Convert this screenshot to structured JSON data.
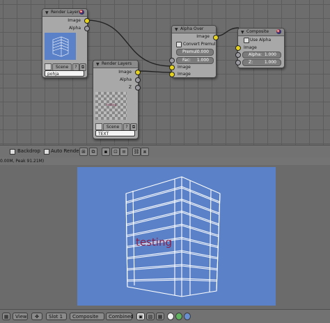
{
  "nodes": {
    "render_layers_1": {
      "title": "Render Layers",
      "outputs": [
        "Image",
        "Alpha"
      ],
      "scene_label": "Scene",
      "layer_value": "pohja"
    },
    "render_layers_2": {
      "title": "Render Layers",
      "outputs": [
        "Image",
        "Alpha",
        "Z"
      ],
      "preview_text": "testing",
      "scene_label": "Scene",
      "layer_value": "TEXT"
    },
    "alpha_over": {
      "title": "Alpha Over",
      "output": "Image",
      "convert_premul_label": "Convert Premul",
      "premul_label": "Premul:",
      "premul_value": "0.000",
      "fac_label": "Fac:",
      "fac_value": "1.000",
      "input1": "Image",
      "input2": "Image"
    },
    "composite": {
      "title": "Composite",
      "use_alpha_label": "Use Alpha",
      "image_label": "Image",
      "alpha_label": "Alpha:",
      "alpha_value": "1.000",
      "z_label": "Z:",
      "z_value": "1.000"
    }
  },
  "header": {
    "backdrop_label": "Backdrop",
    "auto_render_label": "Auto Render"
  },
  "info_text": "0.00M, Peak 91.21M)",
  "render": {
    "overlay_text": "testing",
    "background_color": "#5b82c8",
    "text_color": "#8a1f4a"
  },
  "footer": {
    "view_label": "View",
    "slot_value": "Slot 1",
    "image_value": "Composite",
    "pass_value": "Combined"
  }
}
